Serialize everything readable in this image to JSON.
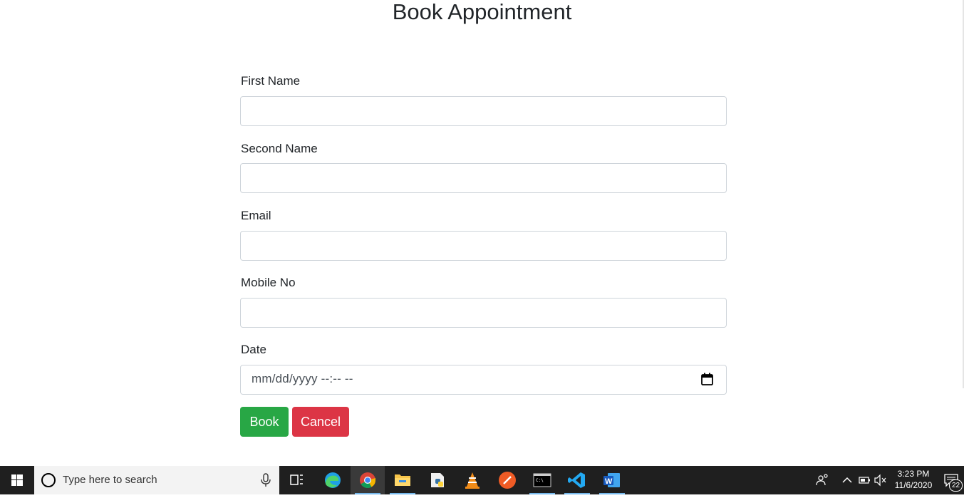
{
  "page": {
    "title": "Book Appointment"
  },
  "form": {
    "fields": [
      {
        "label": "First Name",
        "value": ""
      },
      {
        "label": "Second Name",
        "value": ""
      },
      {
        "label": "Email",
        "value": ""
      },
      {
        "label": "Mobile No",
        "value": ""
      },
      {
        "label": "Date",
        "value": "mm/dd/yyyy --:-- --"
      }
    ],
    "book_label": "Book",
    "cancel_label": "Cancel"
  },
  "taskbar": {
    "search_placeholder": "Type here to search",
    "time": "3:23 PM",
    "date": "11/6/2020",
    "notification_count": "22",
    "apps": [
      "task-view",
      "edge",
      "chrome",
      "file-explorer",
      "python-idle",
      "vlc",
      "postman",
      "terminal",
      "vscode",
      "word"
    ]
  },
  "colors": {
    "book": "#28a745",
    "cancel": "#dc3545",
    "taskbar": "#1f1f1f"
  }
}
